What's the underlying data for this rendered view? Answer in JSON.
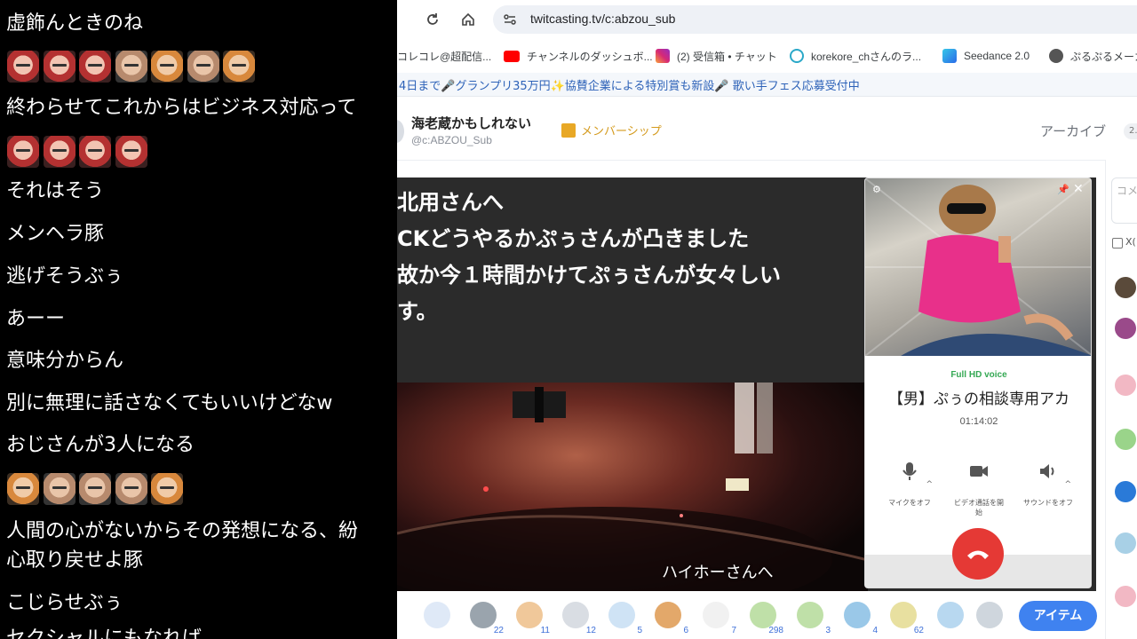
{
  "browser": {
    "url": "twitcasting.tv/c:abzou_sub",
    "bookmarks": [
      "コレコレ@超配信...",
      "チャンネルのダッシュボ...",
      "(2) 受信箱 • チャット",
      "korekore_chさんのラ...",
      "Seedance 2.0",
      "ぷるぷるメーカー"
    ],
    "banner": "4日まで🎤グランプリ35万円✨協賛企業による特別賞も新設🎤 歌い手フェス応募受付中"
  },
  "channel": {
    "name": "海老蔵かもしれない",
    "id": "@c:ABZOU_Sub",
    "membership_label": "メンバーシップ",
    "archive_label": "アーカイブ",
    "archive_count": "2..."
  },
  "video": {
    "telop": [
      "北用さんへ",
      "CKどうやるかぷぅさんが凸きました",
      "故か今１時間かけてぷぅさんが女々しい",
      "す。"
    ],
    "subtitle": "ハイホーさんへ"
  },
  "call": {
    "quality": "Full HD voice",
    "name": "【男】ぷぅの相談専用アカ",
    "timer": "01:14:02",
    "controls": [
      {
        "label": "マイクをオフ",
        "icon": "microphone-icon"
      },
      {
        "label": "ビデオ通話を開始",
        "icon": "video-camera-icon"
      },
      {
        "label": "サウンドをオフ",
        "icon": "speaker-icon"
      }
    ]
  },
  "side": {
    "comment_placeholder": "コメ",
    "x_label": "X(",
    "avatar_colors": [
      "#5a4a3a",
      "#9a4a8a",
      "#f2b8c4",
      "#9ad48a",
      "#2a7ad8",
      "#a8d0e6",
      "#f2b8c4"
    ]
  },
  "gifts": [
    {
      "icon": "smile-gift-icon",
      "count": "",
      "color": "#dfe9f7"
    },
    {
      "icon": "coin-gift-icon",
      "count": "22",
      "color": "#9aa4ad"
    },
    {
      "icon": "clap-gift-icon",
      "count": "11",
      "color": "#f0c89a"
    },
    {
      "icon": "headphones-gift-icon",
      "count": "12",
      "color": "#d9dde3"
    },
    {
      "icon": "ghost-gift-icon",
      "count": "5",
      "color": "#cfe3f5"
    },
    {
      "icon": "bread-gift-icon",
      "count": "6",
      "color": "#e3a86a"
    },
    {
      "icon": "cloud-gift-icon",
      "count": "7",
      "color": "#f1f1f1"
    },
    {
      "icon": "tea-gift-icon",
      "count": "298",
      "color": "#bfe0a8"
    },
    {
      "icon": "tea-stack-gift-icon",
      "count": "3",
      "color": "#bfe0a8"
    },
    {
      "icon": "firework-gift-icon",
      "count": "4",
      "color": "#9ac8e8"
    },
    {
      "icon": "bottle-gift-icon",
      "count": "62",
      "color": "#e8e0a0"
    },
    {
      "icon": "hundred-gift-icon",
      "count": "",
      "color": "#b8d8f0"
    },
    {
      "icon": "coin-silver-gift-icon",
      "count": "",
      "color": "#cfd6dd"
    }
  ],
  "item_button": "アイテム",
  "comments": [
    {
      "type": "text",
      "text": "虚飾んときのね"
    },
    {
      "type": "faces",
      "faces": [
        "red",
        "red",
        "red",
        "plain",
        "sun",
        "plain",
        "sun"
      ]
    },
    {
      "type": "text",
      "text": "終わらせてこれからはビジネス対応って"
    },
    {
      "type": "faces",
      "faces": [
        "red",
        "red",
        "red",
        "red"
      ]
    },
    {
      "type": "text",
      "text": "それはそう"
    },
    {
      "type": "text",
      "text": "メンヘラ豚"
    },
    {
      "type": "text",
      "text": "逃げそうぶぅ"
    },
    {
      "type": "text",
      "text": "あーー"
    },
    {
      "type": "text",
      "text": "意味分からん"
    },
    {
      "type": "text",
      "text": "別に無理に話さなくてもいいけどなw"
    },
    {
      "type": "text",
      "text": "おじさんが3人になる"
    },
    {
      "type": "faces",
      "faces": [
        "sun",
        "plain",
        "plain",
        "plain",
        "sun"
      ]
    },
    {
      "type": "text",
      "text": "人間の心がないからその発想になる、紛"
    },
    {
      "type": "text",
      "text": "心取り戻せよ豚"
    },
    {
      "type": "text",
      "text": "こじらせぶぅ"
    },
    {
      "type": "text",
      "text": "セクシャルにもなれば"
    }
  ]
}
